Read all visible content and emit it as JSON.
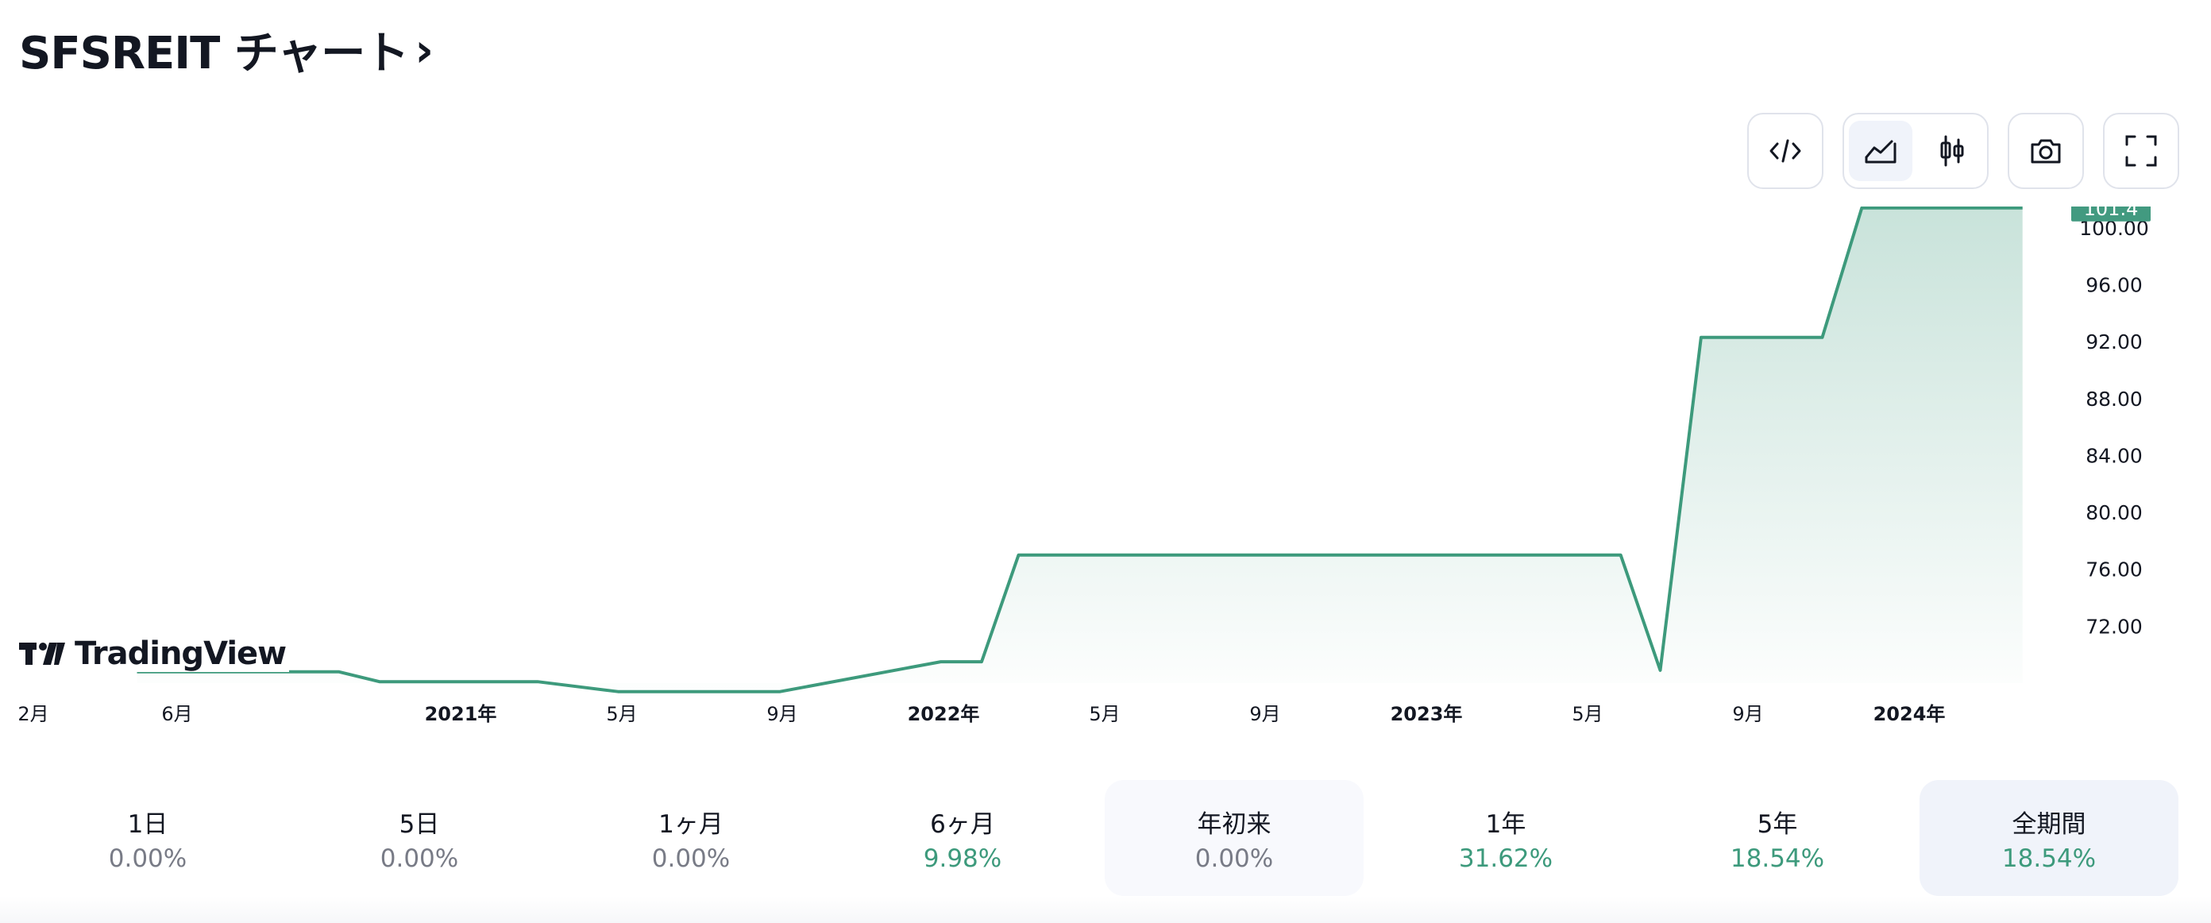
{
  "header": {
    "title": "SFSREIT チャート",
    "chevron": "›"
  },
  "toolbar": {
    "buttons": [
      {
        "name": "embed-code",
        "icon": "code-icon"
      },
      {
        "name": "area-chart-type",
        "icon": "area-chart-icon",
        "active": true
      },
      {
        "name": "candlestick-chart-type",
        "icon": "candlestick-icon"
      },
      {
        "name": "snapshot",
        "icon": "camera-icon"
      },
      {
        "name": "fullscreen",
        "icon": "fullscreen-icon"
      }
    ]
  },
  "branding": {
    "logo_text": "TradingView"
  },
  "chart_data": {
    "type": "area",
    "x_tick_labels": [
      "2月",
      "6月",
      "2021年",
      "5月",
      "9月",
      "2022年",
      "5月",
      "9月",
      "2023年",
      "5月",
      "9月",
      "2024年"
    ],
    "x_tick_bold": [
      false,
      false,
      true,
      false,
      false,
      true,
      false,
      false,
      true,
      false,
      false,
      true
    ],
    "y_ticks": [
      "72.00",
      "76.00",
      "80.00",
      "84.00",
      "88.00",
      "92.00",
      "96.00",
      "100.00"
    ],
    "ylim": [
      68,
      101.5
    ],
    "last_value_label": "101.4",
    "colors": {
      "line": "#3d9a7c",
      "fill": "#3d9a7c",
      "badge": "#429a80"
    },
    "series": [
      {
        "values": [
          {
            "x": "2020-05",
            "y": 68.8
          },
          {
            "x": "2020-10",
            "y": 68.8
          },
          {
            "x": "2020-11",
            "y": 68.1
          },
          {
            "x": "2021-03",
            "y": 68.1
          },
          {
            "x": "2021-05",
            "y": 67.4
          },
          {
            "x": "2021-09",
            "y": 67.4
          },
          {
            "x": "2022-01",
            "y": 69.5
          },
          {
            "x": "2022-02",
            "y": 69.5
          },
          {
            "x": "2022-03",
            "y": 77.0
          },
          {
            "x": "2023-06",
            "y": 77.0
          },
          {
            "x": "2023-07",
            "y": 68.9
          },
          {
            "x": "2023-08",
            "y": 92.3
          },
          {
            "x": "2023-11",
            "y": 92.3
          },
          {
            "x": "2023-12",
            "y": 101.4
          },
          {
            "x": "2024-04",
            "y": 101.4
          }
        ]
      }
    ]
  },
  "periods": [
    {
      "label": "1日",
      "value": "0.00%",
      "positive": false
    },
    {
      "label": "5日",
      "value": "0.00%",
      "positive": false
    },
    {
      "label": "1ヶ月",
      "value": "0.00%",
      "positive": false
    },
    {
      "label": "6ヶ月",
      "value": "9.98%",
      "positive": true
    },
    {
      "label": "年初来",
      "value": "0.00%",
      "positive": false
    },
    {
      "label": "1年",
      "value": "31.62%",
      "positive": true
    },
    {
      "label": "5年",
      "value": "18.54%",
      "positive": true
    },
    {
      "label": "全期間",
      "value": "18.54%",
      "positive": true,
      "selected": true
    }
  ]
}
